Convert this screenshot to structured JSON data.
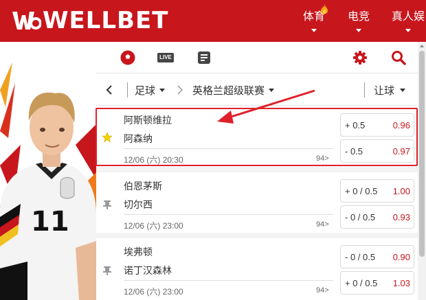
{
  "brand": {
    "name": "WELLBET",
    "accent": "#c8161d"
  },
  "nav": [
    {
      "label": "体育",
      "hot": true
    },
    {
      "label": "电竞",
      "hot": false
    },
    {
      "label": "真人娱",
      "hot": false
    }
  ],
  "tabs": {
    "soccer_icon": "soccer-ball-icon",
    "live_label": "LIVE",
    "list_icon": "document-list-icon",
    "settings_icon": "gear-icon",
    "search_icon": "search-icon"
  },
  "filters": {
    "sport": "足球",
    "league": "英格兰超级联赛",
    "market": "让球"
  },
  "matches": [
    {
      "home": "阿斯顿维拉",
      "away": "阿森纳",
      "time": "12/06 (六) 20:30",
      "more": "94>",
      "odds": [
        {
          "line": "+ 0.5",
          "value": "0.96"
        },
        {
          "line": "- 0.5",
          "value": "0.97"
        }
      ]
    },
    {
      "home": "伯恩茅斯",
      "away": "切尔西",
      "time": "12/06 (六) 23:00",
      "more": "94>",
      "odds": [
        {
          "line": "+ 0 / 0.5",
          "value": "1.00"
        },
        {
          "line": "- 0 / 0.5",
          "value": "0.93"
        }
      ]
    },
    {
      "home": "埃弗顿",
      "away": "诺丁汉森林",
      "time": "12/06 (六) 23:00",
      "more": "94>",
      "odds": [
        {
          "line": "- 0 / 0.5",
          "value": "0.90"
        },
        {
          "line": "+ 0 / 0.5",
          "value": "1.03"
        }
      ]
    }
  ]
}
